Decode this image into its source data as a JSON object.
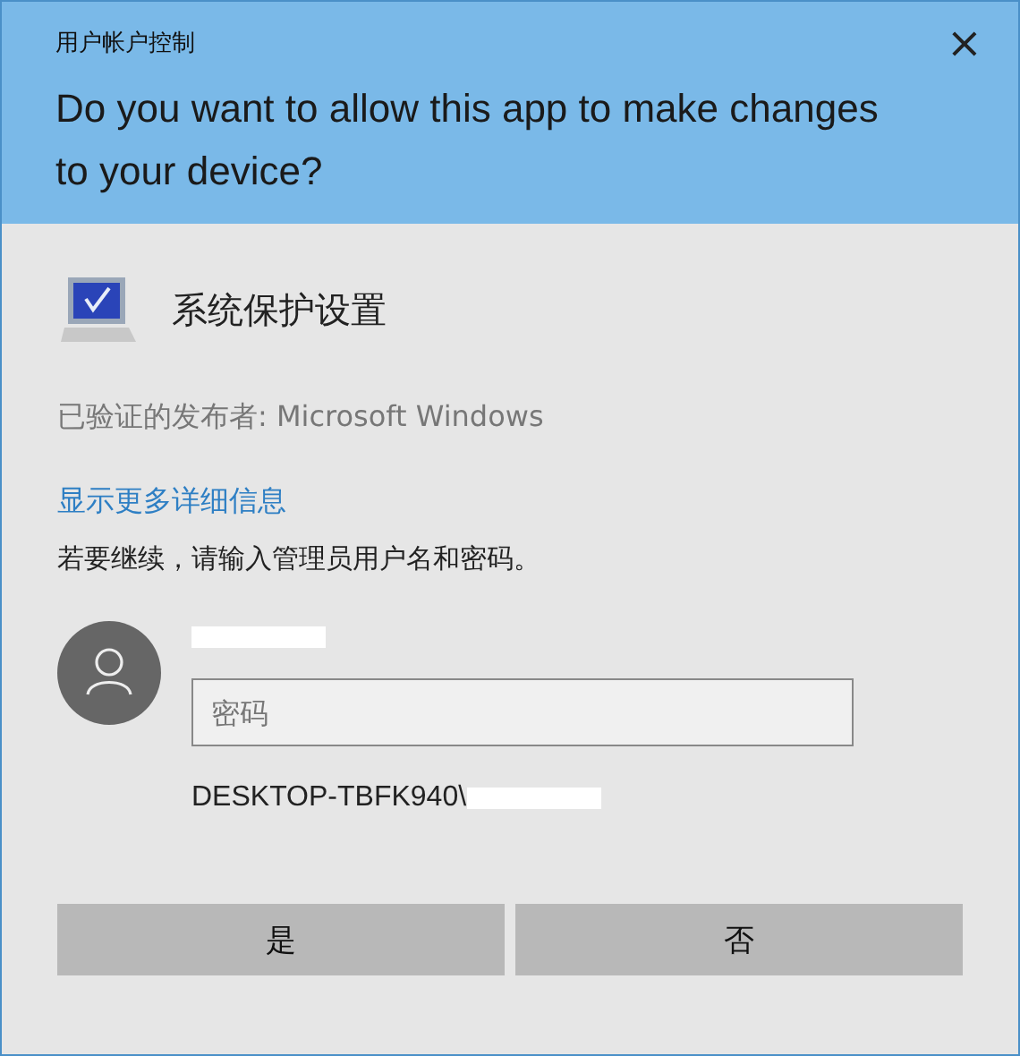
{
  "window": {
    "title": "用户帐户控制",
    "close": "×"
  },
  "heading": "Do you want to allow this app to make changes to your device?",
  "app_name": "系统保护设置",
  "publisher": "已验证的发布者: Microsoft Windows",
  "details_link": "显示更多详细信息",
  "instruction": "若要继续，请输入管理员用户名和密码。",
  "password": {
    "placeholder": "密码"
  },
  "account": "DESKTOP-TBFK940\\",
  "buttons": [
    "是",
    "否"
  ]
}
